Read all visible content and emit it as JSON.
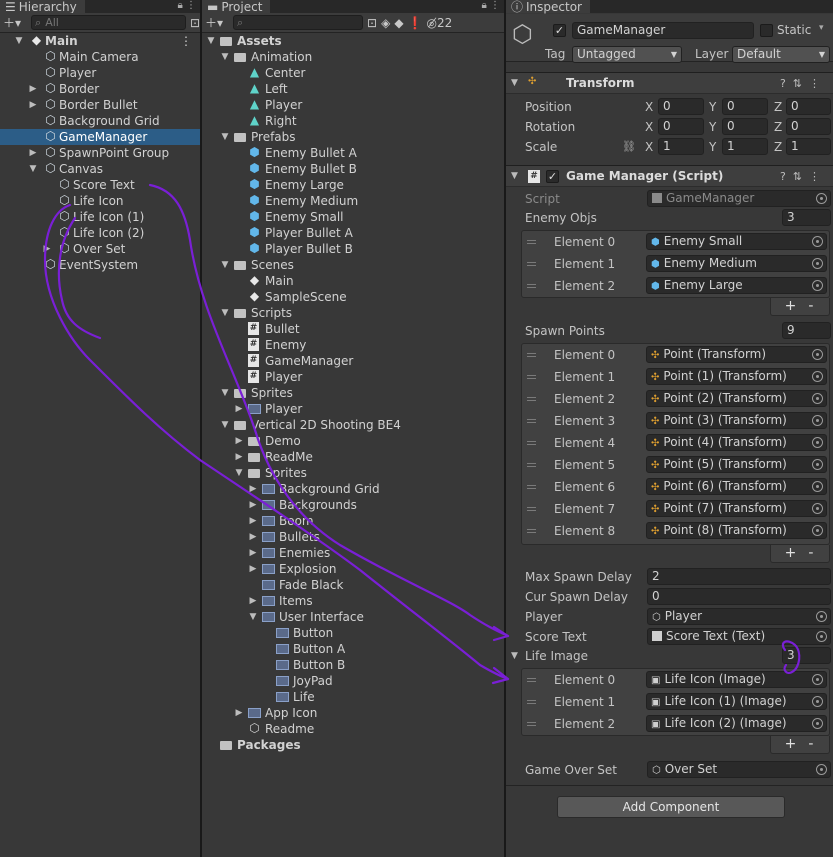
{
  "hierarchy": {
    "tab": "Hierarchy",
    "search_placeholder": "All",
    "items": [
      {
        "label": "Main",
        "kind": "scene"
      },
      {
        "label": "Main Camera",
        "kind": "cube"
      },
      {
        "label": "Player",
        "kind": "cube"
      },
      {
        "label": "Border",
        "kind": "cube"
      },
      {
        "label": "Border Bullet",
        "kind": "cube"
      },
      {
        "label": "Background Grid",
        "kind": "cube"
      },
      {
        "label": "GameManager",
        "kind": "cube",
        "selected": true
      },
      {
        "label": "SpawnPoint Group",
        "kind": "cube"
      },
      {
        "label": "Canvas",
        "kind": "cube"
      },
      {
        "label": "Score Text",
        "kind": "cube"
      },
      {
        "label": "Life Icon",
        "kind": "cube"
      },
      {
        "label": "Life Icon (1)",
        "kind": "cube"
      },
      {
        "label": "Life Icon (2)",
        "kind": "cube"
      },
      {
        "label": "Over Set",
        "kind": "cube"
      },
      {
        "label": "EventSystem",
        "kind": "cube"
      }
    ]
  },
  "project": {
    "tab": "Project",
    "hidden_count": "22",
    "items": [
      {
        "label": "Assets",
        "kind": "folder"
      },
      {
        "label": "Animation",
        "kind": "folder"
      },
      {
        "label": "Center",
        "kind": "anim"
      },
      {
        "label": "Left",
        "kind": "anim"
      },
      {
        "label": "Player",
        "kind": "anim"
      },
      {
        "label": "Right",
        "kind": "anim"
      },
      {
        "label": "Prefabs",
        "kind": "folder"
      },
      {
        "label": "Enemy Bullet A",
        "kind": "prefab"
      },
      {
        "label": "Enemy Bullet B",
        "kind": "prefab"
      },
      {
        "label": "Enemy Large",
        "kind": "prefab"
      },
      {
        "label": "Enemy Medium",
        "kind": "prefab"
      },
      {
        "label": "Enemy Small",
        "kind": "prefab"
      },
      {
        "label": "Player Bullet A",
        "kind": "prefab"
      },
      {
        "label": "Player Bullet B",
        "kind": "prefab"
      },
      {
        "label": "Scenes",
        "kind": "folder"
      },
      {
        "label": "Main",
        "kind": "scene"
      },
      {
        "label": "SampleScene",
        "kind": "scene"
      },
      {
        "label": "Scripts",
        "kind": "folder"
      },
      {
        "label": "Bullet",
        "kind": "script"
      },
      {
        "label": "Enemy",
        "kind": "script"
      },
      {
        "label": "GameManager",
        "kind": "script"
      },
      {
        "label": "Player",
        "kind": "script"
      },
      {
        "label": "Sprites",
        "kind": "folder"
      },
      {
        "label": "Player",
        "kind": "sprite"
      },
      {
        "label": "Vertical 2D Shooting BE4",
        "kind": "folder"
      },
      {
        "label": "Demo",
        "kind": "folder"
      },
      {
        "label": "ReadMe",
        "kind": "folder"
      },
      {
        "label": "Sprites",
        "kind": "folder"
      },
      {
        "label": "Background Grid",
        "kind": "sprite"
      },
      {
        "label": "Backgrounds",
        "kind": "sprite"
      },
      {
        "label": "Boom",
        "kind": "sprite"
      },
      {
        "label": "Bullets",
        "kind": "sprite"
      },
      {
        "label": "Enemies",
        "kind": "sprite"
      },
      {
        "label": "Explosion",
        "kind": "sprite"
      },
      {
        "label": "Fade Black",
        "kind": "sprite"
      },
      {
        "label": "Items",
        "kind": "sprite"
      },
      {
        "label": "User Interface",
        "kind": "sprite"
      },
      {
        "label": "Button",
        "kind": "sprite"
      },
      {
        "label": "Button A",
        "kind": "sprite"
      },
      {
        "label": "Button B",
        "kind": "sprite"
      },
      {
        "label": "JoyPad",
        "kind": "sprite"
      },
      {
        "label": "Life",
        "kind": "sprite"
      },
      {
        "label": "App Icon",
        "kind": "sprite"
      },
      {
        "label": "Readme",
        "kind": "asset"
      },
      {
        "label": "Packages",
        "kind": "folder"
      }
    ]
  },
  "inspector": {
    "tab": "Inspector",
    "object_name": "GameManager",
    "static_label": "Static",
    "tag_label": "Tag",
    "tag_value": "Untagged",
    "layer_label": "Layer",
    "layer_value": "Default",
    "transform": {
      "title": "Transform",
      "position_label": "Position",
      "rotation_label": "Rotation",
      "scale_label": "Scale",
      "x": "X",
      "y": "Y",
      "z": "Z",
      "position": [
        "0",
        "0",
        "0"
      ],
      "rotation": [
        "0",
        "0",
        "0"
      ],
      "scale": [
        "1",
        "1",
        "1"
      ]
    },
    "script_component": {
      "title": "Game Manager (Script)",
      "script_label": "Script",
      "script_value": "GameManager",
      "enemy_objs_label": "Enemy Objs",
      "enemy_objs_count": "3",
      "enemy_objs": [
        "Enemy Small",
        "Enemy Medium",
        "Enemy Large"
      ],
      "spawn_points_label": "Spawn Points",
      "spawn_points_count": "9",
      "spawn_points": [
        "Point (Transform)",
        "Point (1) (Transform)",
        "Point (2) (Transform)",
        "Point (3) (Transform)",
        "Point (4) (Transform)",
        "Point (5) (Transform)",
        "Point (6) (Transform)",
        "Point (7) (Transform)",
        "Point (8) (Transform)"
      ],
      "element_labels": [
        "Element 0",
        "Element 1",
        "Element 2",
        "Element 3",
        "Element 4",
        "Element 5",
        "Element 6",
        "Element 7",
        "Element 8"
      ],
      "max_spawn_delay_label": "Max Spawn Delay",
      "max_spawn_delay": "2",
      "cur_spawn_delay_label": "Cur Spawn Delay",
      "cur_spawn_delay": "0",
      "player_label": "Player",
      "player_value": "Player",
      "score_text_label": "Score Text",
      "score_text_value": "Score Text (Text)",
      "life_image_label": "Life Image",
      "life_image_count": "3",
      "life_images": [
        "Life Icon (Image)",
        "Life Icon (1) (Image)",
        "Life Icon (2) (Image)"
      ],
      "game_over_set_label": "Game Over Set",
      "game_over_set_value": "Over Set"
    },
    "add_component": "Add Component",
    "plus_minus": "+ -"
  },
  "colors": {
    "selection": "#2c5d87",
    "annotation": "#7a1fd6",
    "prefab": "#62b7ea"
  }
}
